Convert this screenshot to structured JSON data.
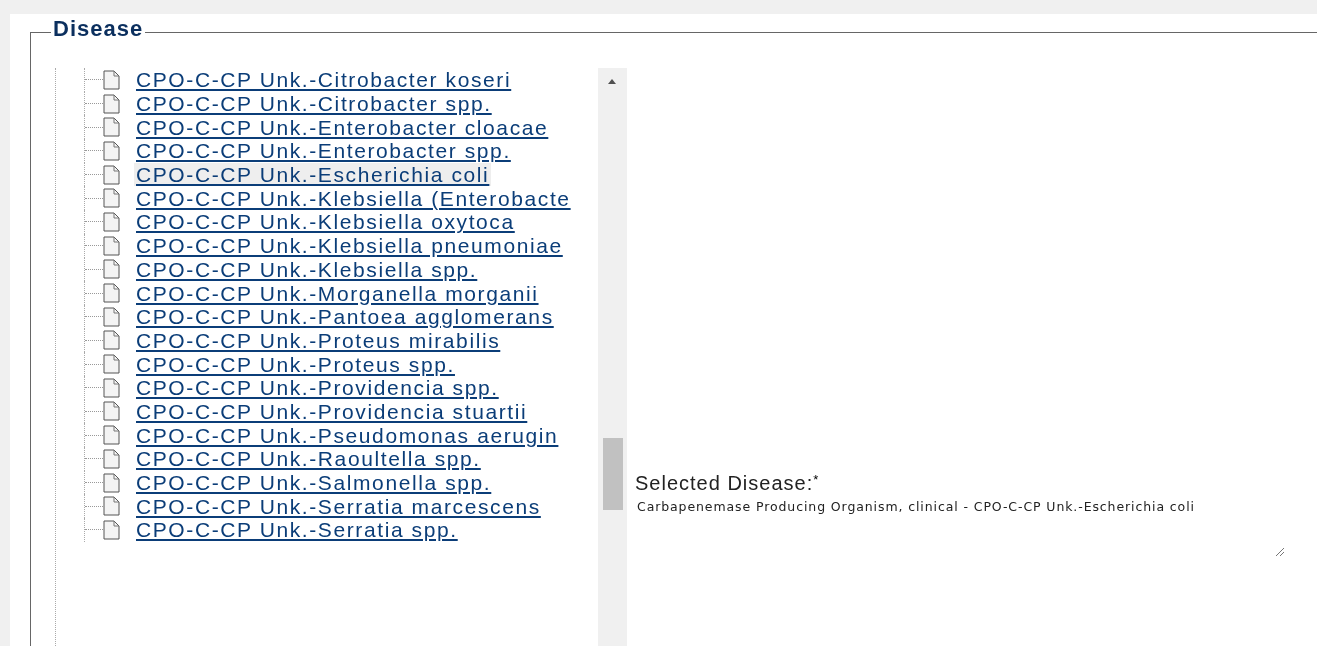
{
  "section": {
    "title": "Disease"
  },
  "tree": {
    "items": [
      {
        "label": "CPO-C-CP Unk.-Citrobacter koseri",
        "selected": false
      },
      {
        "label": "CPO-C-CP Unk.-Citrobacter spp.",
        "selected": false
      },
      {
        "label": "CPO-C-CP Unk.-Enterobacter cloacae",
        "selected": false
      },
      {
        "label": "CPO-C-CP Unk.-Enterobacter spp.",
        "selected": false
      },
      {
        "label": "CPO-C-CP Unk.-Escherichia coli",
        "selected": true
      },
      {
        "label": "CPO-C-CP Unk.-Klebsiella (Enterobacte",
        "selected": false
      },
      {
        "label": "CPO-C-CP Unk.-Klebsiella oxytoca",
        "selected": false
      },
      {
        "label": "CPO-C-CP Unk.-Klebsiella pneumoniae",
        "selected": false
      },
      {
        "label": "CPO-C-CP Unk.-Klebsiella spp.",
        "selected": false
      },
      {
        "label": "CPO-C-CP Unk.-Morganella morganii",
        "selected": false
      },
      {
        "label": "CPO-C-CP Unk.-Pantoea agglomerans",
        "selected": false
      },
      {
        "label": "CPO-C-CP Unk.-Proteus mirabilis",
        "selected": false
      },
      {
        "label": "CPO-C-CP Unk.-Proteus spp.",
        "selected": false
      },
      {
        "label": "CPO-C-CP Unk.-Providencia spp.",
        "selected": false
      },
      {
        "label": "CPO-C-CP Unk.-Providencia stuartii",
        "selected": false
      },
      {
        "label": "CPO-C-CP Unk.-Pseudomonas aerugin",
        "selected": false
      },
      {
        "label": "CPO-C-CP Unk.-Raoultella spp.",
        "selected": false
      },
      {
        "label": "CPO-C-CP Unk.-Salmonella spp.",
        "selected": false
      },
      {
        "label": "CPO-C-CP Unk.-Serratia marcescens",
        "selected": false
      },
      {
        "label": "CPO-C-CP Unk.-Serratia spp.",
        "selected": false
      }
    ]
  },
  "selected_disease": {
    "label": "Selected Disease:",
    "required_mark": "*",
    "value": "Carbapenemase Producing Organism, clinical - CPO-C-CP Unk.-Escherichia coli"
  }
}
